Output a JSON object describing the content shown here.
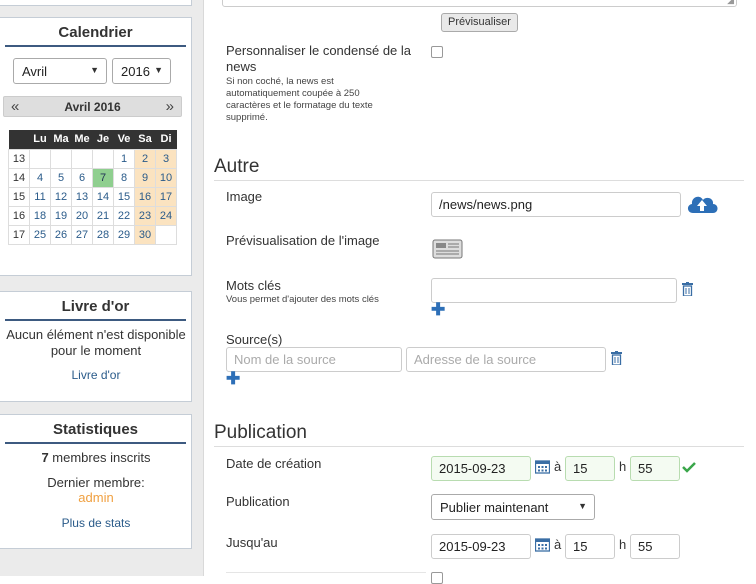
{
  "sidebar": {
    "calendar": {
      "title": "Calendrier",
      "month_select": "Avril",
      "year_select": "2016",
      "nav_label": "Avril 2016",
      "weekdays": [
        "Lu",
        "Ma",
        "Me",
        "Je",
        "Ve",
        "Sa",
        "Di"
      ],
      "weeks": [
        {
          "num": "13",
          "days": [
            "",
            "",
            "",
            "",
            "1",
            "2",
            "3"
          ]
        },
        {
          "num": "14",
          "days": [
            "4",
            "5",
            "6",
            "7",
            "8",
            "9",
            "10"
          ]
        },
        {
          "num": "15",
          "days": [
            "11",
            "12",
            "13",
            "14",
            "15",
            "16",
            "17"
          ]
        },
        {
          "num": "16",
          "days": [
            "18",
            "19",
            "20",
            "21",
            "22",
            "23",
            "24"
          ]
        },
        {
          "num": "17",
          "days": [
            "25",
            "26",
            "27",
            "28",
            "29",
            "30",
            ""
          ]
        }
      ],
      "today": "7"
    },
    "guestbook": {
      "title": "Livre d'or",
      "empty_text": "Aucun élément n'est disponible pour le moment",
      "link": "Livre d'or"
    },
    "stats": {
      "title": "Statistiques",
      "members_count": "7",
      "members_text": "membres inscrits",
      "last_member_label": "Dernier membre:",
      "last_member": "admin",
      "more_link": "Plus de stats"
    }
  },
  "form": {
    "preview_button": "Prévisualiser",
    "summary": {
      "label": "Personnaliser le condensé de la news",
      "help": "Si non coché, la news est automatiquement coupée à 250 caractères et le formatage du texte supprimé.",
      "checked": false
    },
    "other_section": "Autre",
    "image": {
      "label": "Image",
      "value": "/news/news.png"
    },
    "image_preview_label": "Prévisualisation de l'image",
    "keywords": {
      "label": "Mots clés",
      "help": "Vous permet d'ajouter des mots clés",
      "value": ""
    },
    "sources": {
      "label": "Source(s)",
      "name_placeholder": "Nom de la source",
      "url_placeholder": "Adresse de la source"
    },
    "publication_section": "Publication",
    "created": {
      "label": "Date de création",
      "date": "2015-09-23",
      "sep": "à",
      "hour": "15",
      "h": "h",
      "minute": "55"
    },
    "publication": {
      "label": "Publication",
      "selected": "Publier maintenant"
    },
    "until": {
      "label": "Jusqu'au",
      "date": "2015-09-23",
      "sep": "à",
      "hour": "15",
      "h": "h",
      "minute": "55"
    }
  },
  "colors": {
    "accent": "#3d5a80",
    "link": "#2a5b8a",
    "weekend": "#fbe3c0",
    "today": "#8fcf8f",
    "success": "#3aa64a",
    "admin": "#f0a040"
  }
}
